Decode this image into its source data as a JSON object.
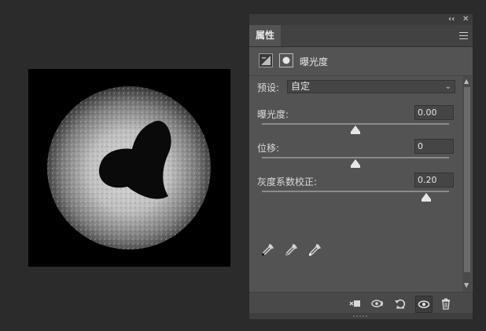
{
  "titlebar": {
    "collapse_icon": "double-chevron-left-icon",
    "close_icon": "close-icon"
  },
  "tabs": [
    {
      "label": "属性"
    }
  ],
  "panel": {
    "title": "曝光度",
    "preset_label": "预设:",
    "preset_value": "自定",
    "controls": [
      {
        "label": "曝光度:",
        "value": "0.00",
        "slider_position": 0.5
      },
      {
        "label": "位移:",
        "value": "0",
        "slider_position": 0.5
      },
      {
        "label": "灰度系数校正:",
        "value": "0.20",
        "slider_position": 0.88
      }
    ],
    "eyedroppers": [
      "black-point-eyedropper-icon",
      "gray-point-eyedropper-icon",
      "white-point-eyedropper-icon"
    ]
  },
  "footer": {
    "icons": [
      "clip-to-layer-icon",
      "view-previous-state-icon",
      "reset-icon",
      "visibility-eye-icon",
      "trash-icon"
    ]
  }
}
